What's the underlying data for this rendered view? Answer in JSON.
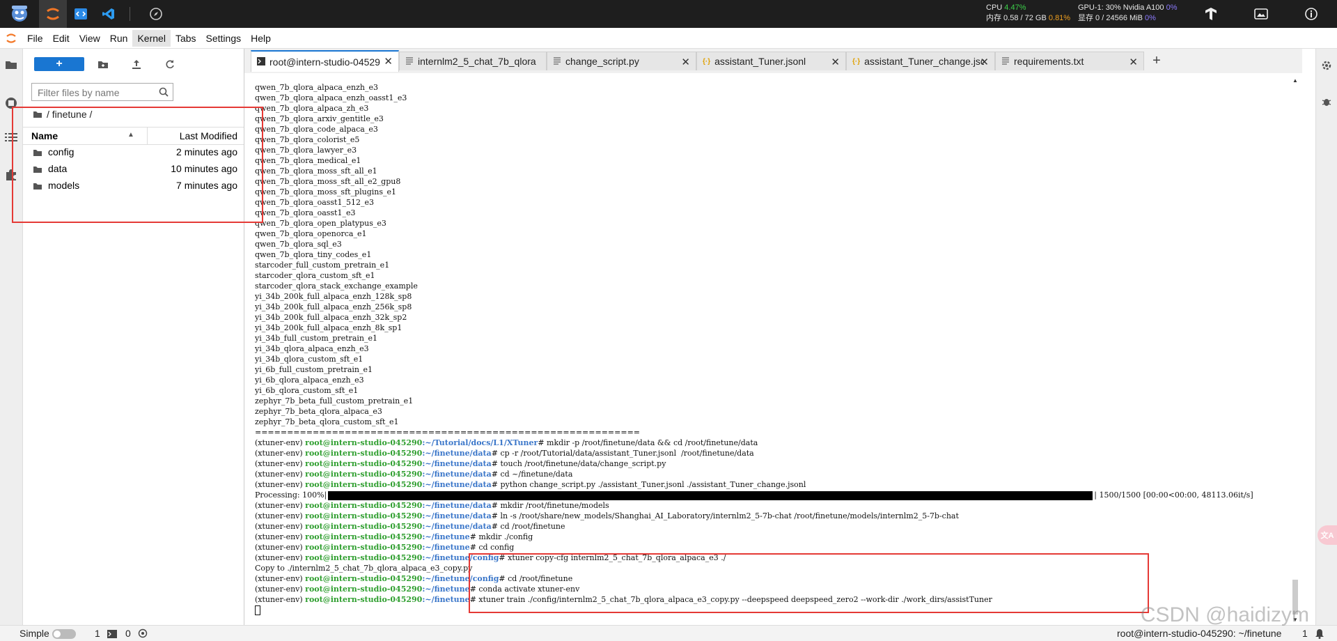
{
  "topbar": {
    "cpu_label": "CPU",
    "cpu_value": "4.47%",
    "mem_label": "内存 0.58 / 72 GB",
    "mem_value": "0.81%",
    "gpu_label": "GPU-1: 30% Nvidia A100",
    "gpu_value": "0%",
    "vram_label": "显存 0 / 24566 MiB",
    "vram_value": "0%"
  },
  "menu": [
    "File",
    "Edit",
    "View",
    "Run",
    "Kernel",
    "Tabs",
    "Settings",
    "Help"
  ],
  "filebrowser": {
    "new_label": "+",
    "search_placeholder": "Filter files by name",
    "breadcrumb": "/ finetune /",
    "col_name": "Name",
    "col_modified": "Last Modified",
    "items": [
      {
        "name": "config",
        "modified": "2 minutes ago"
      },
      {
        "name": "data",
        "modified": "10 minutes ago"
      },
      {
        "name": "models",
        "modified": "7 minutes ago"
      }
    ]
  },
  "tabs": [
    {
      "label": "root@intern-studio-04529",
      "icon": "terminal-icon"
    },
    {
      "label": "internlm2_5_chat_7b_qlora",
      "icon": "file-icon"
    },
    {
      "label": "change_script.py",
      "icon": "file-icon"
    },
    {
      "label": "assistant_Tuner.jsonl",
      "icon": "json-icon"
    },
    {
      "label": "assistant_Tuner_change.jsonl",
      "icon": "json-icon"
    },
    {
      "label": "requirements.txt",
      "icon": "file-icon"
    }
  ],
  "terminal": {
    "list": [
      "qwen_7b_qlora_alpaca_enzh_e3",
      "qwen_7b_qlora_alpaca_enzh_oasst1_e3",
      "qwen_7b_qlora_alpaca_zh_e3",
      "qwen_7b_qlora_arxiv_gentitle_e3",
      "qwen_7b_qlora_code_alpaca_e3",
      "qwen_7b_qlora_colorist_e5",
      "qwen_7b_qlora_lawyer_e3",
      "qwen_7b_qlora_medical_e1",
      "qwen_7b_qlora_moss_sft_all_e1",
      "qwen_7b_qlora_moss_sft_all_e2_gpu8",
      "qwen_7b_qlora_moss_sft_plugins_e1",
      "qwen_7b_qlora_oasst1_512_e3",
      "qwen_7b_qlora_oasst1_e3",
      "qwen_7b_qlora_open_platypus_e3",
      "qwen_7b_qlora_openorca_e1",
      "qwen_7b_qlora_sql_e3",
      "qwen_7b_qlora_tiny_codes_e1",
      "starcoder_full_custom_pretrain_e1",
      "starcoder_qlora_custom_sft_e1",
      "starcoder_qlora_stack_exchange_example",
      "yi_34b_200k_full_alpaca_enzh_128k_sp8",
      "yi_34b_200k_full_alpaca_enzh_256k_sp8",
      "yi_34b_200k_full_alpaca_enzh_32k_sp2",
      "yi_34b_200k_full_alpaca_enzh_8k_sp1",
      "yi_34b_full_custom_pretrain_e1",
      "yi_34b_qlora_alpaca_enzh_e3",
      "yi_34b_qlora_custom_sft_e1",
      "yi_6b_full_custom_pretrain_e1",
      "yi_6b_qlora_alpaca_enzh_e3",
      "yi_6b_qlora_custom_sft_e1",
      "zephyr_7b_beta_full_custom_pretrain_e1",
      "zephyr_7b_beta_qlora_alpaca_e3",
      "zephyr_7b_beta_qlora_custom_sft_e1",
      "============================================================"
    ],
    "env": "(xtuner-env)",
    "host": "root@intern-studio-045290",
    "commands": [
      {
        "path": ":~/Tutorial/docs/L1/XTuner",
        "cmd": "# mkdir -p /root/finetune/data && cd /root/finetune/data"
      },
      {
        "path": ":~/finetune/data",
        "cmd": "# cp -r /root/Tutorial/data/assistant_Tuner.jsonl  /root/finetune/data"
      },
      {
        "path": ":~/finetune/data",
        "cmd": "# touch /root/finetune/data/change_script.py"
      },
      {
        "path": ":~/finetune/data",
        "cmd": "# cd ~/finetune/data"
      },
      {
        "path": ":~/finetune/data",
        "cmd": "# python change_script.py ./assistant_Tuner.jsonl ./assistant_Tuner_change.jsonl"
      }
    ],
    "processing_prefix": "Processing: 100%|",
    "processing_suffix": "| 1500/1500 [00:00<00:00, 48113.06it/s]",
    "processing_fraction": 1.0,
    "commands2": [
      {
        "path": ":~/finetune/data",
        "cmd": "# mkdir /root/finetune/models"
      },
      {
        "path": ":~/finetune/data",
        "cmd": "# ln -s /root/share/new_models/Shanghai_AI_Laboratory/internlm2_5-7b-chat /root/finetune/models/internlm2_5-7b-chat"
      },
      {
        "path": ":~/finetune/data",
        "cmd": "# cd /root/finetune"
      },
      {
        "path": ":~/finetune",
        "cmd": "# mkdir ./config"
      },
      {
        "path": ":~/finetune",
        "cmd": "# cd config"
      },
      {
        "path": ":~/finetune/config",
        "cmd": "# xtuner copy-cfg internlm2_5_chat_7b_qlora_alpaca_e3 ./"
      }
    ],
    "copy_output": "Copy to ./internlm2_5_chat_7b_qlora_alpaca_e3_copy.py",
    "commands3": [
      {
        "path": ":~/finetune/config",
        "cmd": "# cd /root/finetune"
      },
      {
        "path": ":~/finetune",
        "cmd": "# conda activate xtuner-env"
      },
      {
        "path": ":~/finetune",
        "cmd": "# xtuner train ./config/internlm2_5_chat_7b_qlora_alpaca_e3_copy.py --deepspeed deepspeed_zero2 --work-dir ./work_dirs/assistTuner"
      }
    ]
  },
  "statusbar": {
    "mode": "Simple",
    "count1": "1",
    "count2": "0",
    "right_text": "root@intern-studio-045290: ~/finetune",
    "right_num": "1"
  },
  "watermark": "CSDN @haidizym",
  "accent_color": "#1976d2",
  "annotation_color": "#e53935"
}
